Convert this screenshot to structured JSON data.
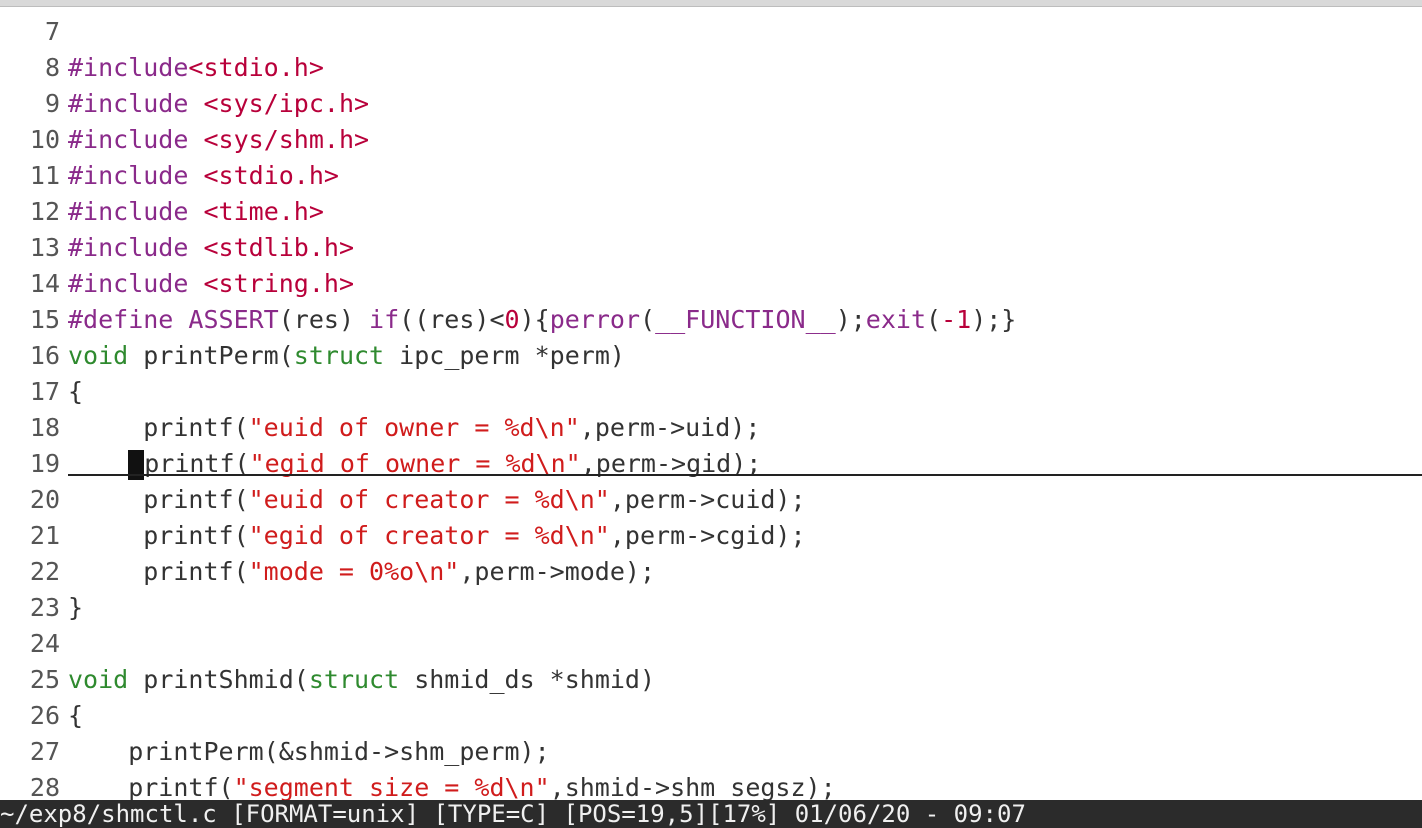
{
  "editor": {
    "lines": [
      {
        "n": "7",
        "code": ""
      },
      {
        "n": "8",
        "code": "#include<stdio.h>"
      },
      {
        "n": "9",
        "code": "#include <sys/ipc.h>"
      },
      {
        "n": "10",
        "code": "#include <sys/shm.h>"
      },
      {
        "n": "11",
        "code": "#include <stdio.h>"
      },
      {
        "n": "12",
        "code": "#include <time.h>"
      },
      {
        "n": "13",
        "code": "#include <stdlib.h>"
      },
      {
        "n": "14",
        "code": "#include <string.h>"
      },
      {
        "n": "15",
        "code": "#define ASSERT(res) if((res)<0){perror(__FUNCTION__);exit(-1);}"
      },
      {
        "n": "16",
        "code": "void printPerm(struct ipc_perm *perm)"
      },
      {
        "n": "17",
        "code": "{"
      },
      {
        "n": "18",
        "code": "     printf(\"euid of owner = %d\\n\",perm->uid);"
      },
      {
        "n": "19",
        "code": "     printf(\"egid of owner = %d\\n\",perm->gid);"
      },
      {
        "n": "20",
        "code": "     printf(\"euid of creator = %d\\n\",perm->cuid);"
      },
      {
        "n": "21",
        "code": "     printf(\"egid of creator = %d\\n\",perm->cgid);"
      },
      {
        "n": "22",
        "code": "     printf(\"mode = 0%o\\n\",perm->mode);"
      },
      {
        "n": "23",
        "code": "}"
      },
      {
        "n": "24",
        "code": ""
      },
      {
        "n": "25",
        "code": "void printShmid(struct shmid_ds *shmid)"
      },
      {
        "n": "26",
        "code": "{"
      },
      {
        "n": "27",
        "code": "    printPerm(&shmid->shm_perm);"
      },
      {
        "n": "28",
        "code": "    printf(\"segment size = %d\\n\",shmid->shm_segsz);"
      }
    ],
    "cursor_line": "19"
  },
  "statusline": {
    "text": "~/exp8/shmctl.c [FORMAT=unix] [TYPE=C] [POS=19,5][17%] 01/06/20 - 09:07"
  },
  "colors": {
    "keyword": "#8a2a8a",
    "type": "#2f8a2f",
    "string": "#d01c1c",
    "include": "#b8003a",
    "text": "#333333",
    "statusline_bg": "#2b2b2b",
    "statusline_fg": "#f0f0f0"
  }
}
